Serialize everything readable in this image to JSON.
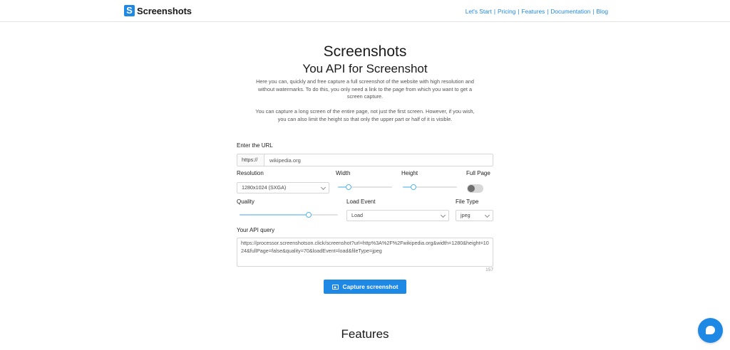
{
  "header": {
    "logo_letter": "S",
    "logo_text": "Screenshots",
    "nav": [
      "Let's Start",
      "Pricing",
      "Features",
      "Documentation",
      "Blog"
    ],
    "nav_separator": "|"
  },
  "hero": {
    "title": "Screenshots",
    "subtitle": "You API for Screenshot",
    "paragraph1": "Here you can, quickly and free capture a full screenshot of the website with high resolution and without watermarks. To do this, you only need a link to the page from which you want to get a screen capture.",
    "paragraph2": "You can capture a long screen of the entire page, not just the first screen. However, if you wish, you can also limit the height so that only the upper part or half of it is visible."
  },
  "form": {
    "url_label": "Enter the URL",
    "url_prefix": "https://",
    "url_value": "wikipedia.org",
    "resolution_label": "Resolution",
    "resolution_value": "1280x1024 (SXGA)",
    "width_label": "Width",
    "width_level": 0.2,
    "height_label": "Height",
    "height_level": 0.2,
    "fullpage_label": "Full Page",
    "fullpage_on": false,
    "quality_label": "Quality",
    "quality_level": 0.7,
    "load_event_label": "Load Event",
    "load_event_value": "Load",
    "file_type_label": "File Type",
    "file_type_value": "jpeg",
    "query_label": "Your API query",
    "query_value": "https://processor.screenshotson.click/screenshot?url=http%3A%2F%2Fwikipedia.org&width=1280&height=1024&fullPage=false&quality=70&loadEvent=load&fileType=jpeg",
    "query_count": "157",
    "capture_button": "Capture screenshot"
  },
  "features_title": "Features",
  "colors": {
    "accent": "#1e88e5",
    "slider_fill": "#9fd3f2",
    "slider_thumb": "#56b4e9"
  },
  "icons": {
    "logo": "logo-s-icon",
    "capture": "image-icon",
    "chat": "chat-bubble-icon",
    "select": "chevron-down-icon"
  }
}
